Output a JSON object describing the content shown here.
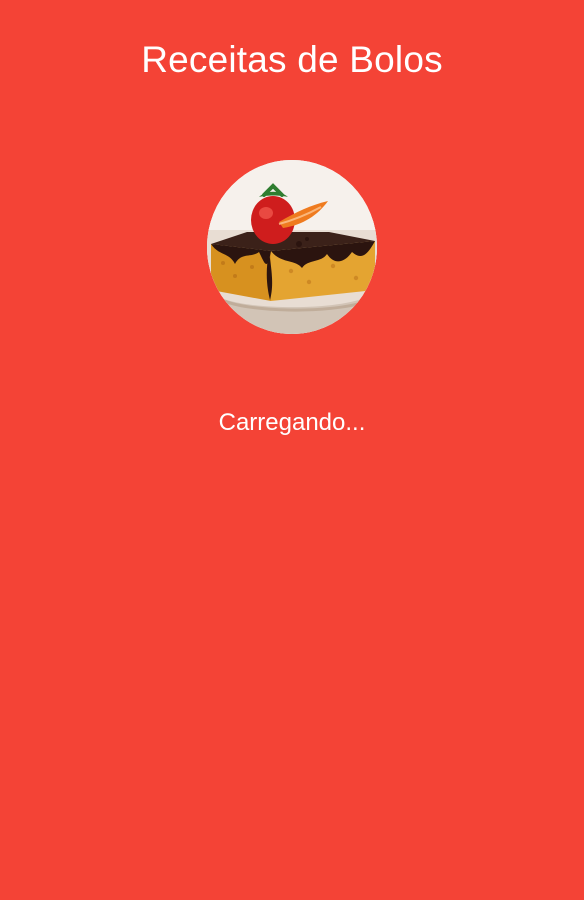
{
  "app": {
    "title": "Receitas de Bolos",
    "loading_text": "Carregando...",
    "background_color": "#f44336",
    "text_color": "#ffffff"
  },
  "logo": {
    "icon": "cake-slice-icon"
  }
}
